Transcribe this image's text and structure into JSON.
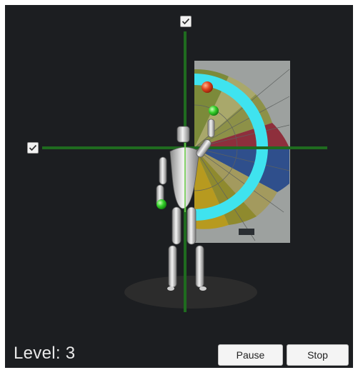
{
  "hud": {
    "level_text": "Level: 3"
  },
  "controls": {
    "pause_label": "Pause",
    "stop_label": "Stop"
  },
  "toggles": {
    "vertical_axis_checked": true,
    "horizontal_axis_checked": true
  },
  "colors": {
    "background": "#1c1e21",
    "axis_green": "#1f6b1f",
    "arc_cyan": "#3fe3ef",
    "target_red": "#e0451f",
    "marker_green": "#35d02b"
  },
  "icons": {
    "checkbox": "check-icon"
  }
}
